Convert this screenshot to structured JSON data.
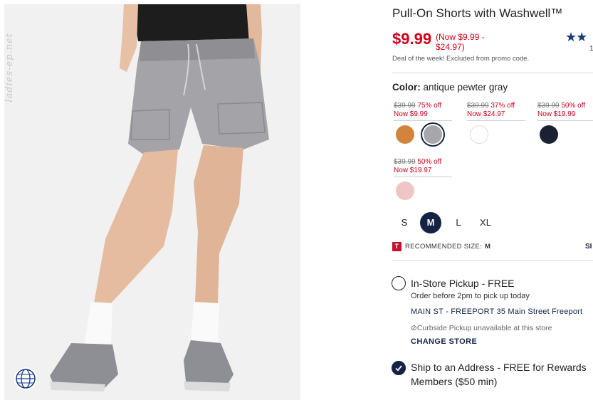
{
  "photo": {
    "watermark": "ladies-ep.net",
    "alt_icon": "globe-icon"
  },
  "product": {
    "title": "Pull-On Shorts with Washwell™",
    "price": "$9.99",
    "price_now_line1": "(Now $9.99 -",
    "price_now_line2": "$24.97)",
    "stars": "★★",
    "review_count": "1",
    "deal_text": "Deal of the week! Excluded from promo code."
  },
  "color": {
    "label": "Color:",
    "value": "antique pewter gray",
    "offers": [
      {
        "was": "$39.99",
        "off": "75% off",
        "now": "Now $9.99"
      },
      {
        "was": "$39.99",
        "off": "37% off",
        "now": "Now $24.97"
      },
      {
        "was": "$39.99",
        "off": "50% off",
        "now": "Now $19.99"
      },
      {
        "was": "$39.99",
        "off": "50% off",
        "now": "Now $19.97"
      }
    ],
    "swatches": [
      {
        "name": "orange-swatch",
        "hex": "#d2843c",
        "selected": false
      },
      {
        "name": "gray-swatch",
        "hex": "#a7a7ab",
        "selected": true
      },
      {
        "name": "white-swatch",
        "hex": "#ffffff",
        "selected": false
      },
      {
        "name": "navy-swatch",
        "hex": "#1b2033",
        "selected": false
      },
      {
        "name": "pink-swatch",
        "hex": "#efc5c5",
        "selected": false
      }
    ]
  },
  "sizes": {
    "options": [
      "S",
      "M",
      "L",
      "XL"
    ],
    "selected": "M"
  },
  "recommended": {
    "badge": "T",
    "label": "RECOMMENDED SIZE:",
    "size": "M",
    "size_chart": "SI"
  },
  "fulfillment": {
    "pickup_title": "In-Store Pickup - FREE",
    "pickup_note": "Order before 2pm to pick up today",
    "store": "MAIN ST - FREEPORT 35 Main Street Freeport",
    "curbside": "Curbside Pickup unavailable at this store",
    "change_store": "CHANGE STORE",
    "ship_title_line1": "Ship to an Address - FREE for Rewards",
    "ship_title_line2": "Members ($50 min)"
  },
  "colors": {
    "accent_navy": "#122344",
    "sale_red": "#d0021b",
    "badge_red": "#c8102e"
  }
}
